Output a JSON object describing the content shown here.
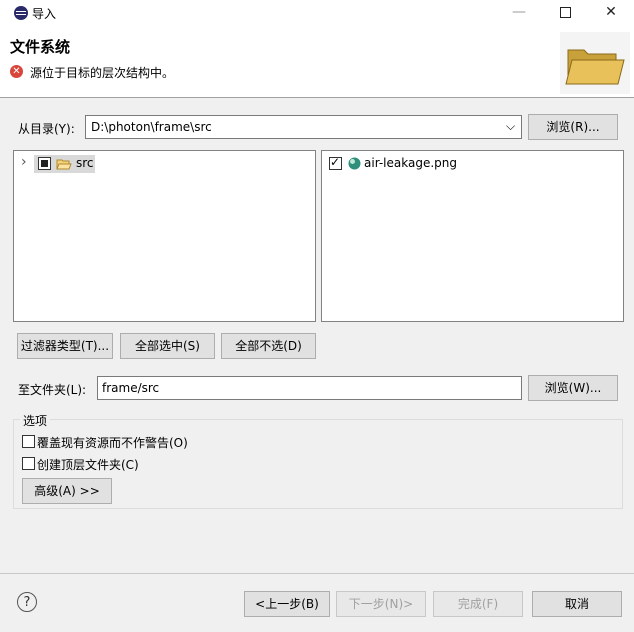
{
  "window": {
    "title": "导入",
    "minimize": "—",
    "close": "✕"
  },
  "header": {
    "title": "文件系统",
    "error_message": "源位于目标的层次结构中。",
    "error_icon_glyph": "✕"
  },
  "from_dir": {
    "label": "从目录(Y):",
    "value": "D:\\photon\\frame\\src",
    "dropdown_glyph": "⌵",
    "browse_label": "浏览(R)..."
  },
  "tree": {
    "expander_glyph": "›",
    "items": [
      {
        "label": "src",
        "state": "partial"
      }
    ]
  },
  "files": {
    "items": [
      {
        "label": "air-leakage.png",
        "checked": true
      }
    ]
  },
  "selection_buttons": {
    "filter_types": "过滤器类型(T)...",
    "select_all": "全部选中(S)",
    "deselect_all": "全部不选(D)"
  },
  "into_folder": {
    "label": "至文件夹(L):",
    "value": "frame/src",
    "browse_label": "浏览(W)..."
  },
  "options": {
    "group_label": "选项",
    "overwrite_label": "覆盖现有资源而不作警告(O)",
    "overwrite_checked": false,
    "create_top_folder_label": "创建顶层文件夹(C)",
    "create_top_folder_checked": false,
    "advanced_label": "高级(A) >>"
  },
  "footer": {
    "help_glyph": "?",
    "back_label": "<上一步(B)",
    "next_label": "下一步(N)>",
    "finish_label": "完成(F)",
    "cancel_label": "取消"
  },
  "colors": {
    "error_red": "#d9453a",
    "folder_yellow": "#e8c15a",
    "selection_gray": "#d9d9d9"
  }
}
